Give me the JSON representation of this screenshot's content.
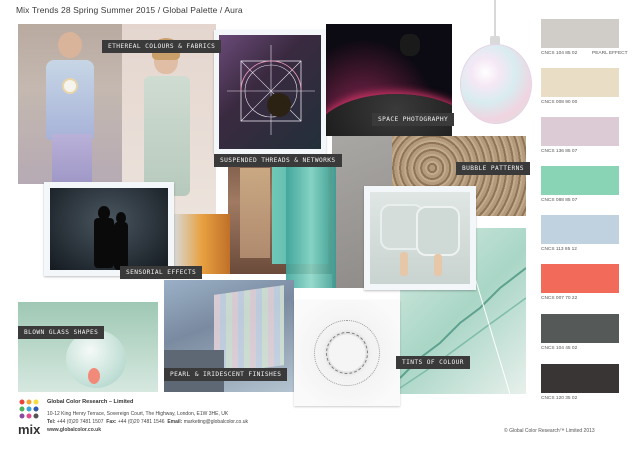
{
  "header": {
    "title": "Mix Trends 28 Spring Summer 2015 / Global Palette / Aura"
  },
  "labels": {
    "ethereal": "ETHEREAL COLOURS & FABRICS",
    "suspended": "SUSPENDED THREADS & NETWORKS",
    "space": "SPACE PHOTOGRAPHY",
    "bubble": "BUBBLE PATTERNS",
    "sensorial": "SENSORIAL EFFECTS",
    "blown": "BLOWN GLASS SHAPES",
    "pearl": "PEARL & IRIDESCENT FINISHES",
    "tints": "TINTS OF COLOUR"
  },
  "palette": {
    "swatches": [
      {
        "code": "CNCS 104 85 02",
        "name": "PEARL EFFECT",
        "color": "#d0cdc8"
      },
      {
        "code": "CNCS 008 90 00",
        "name": "",
        "color": "#e9ddc6"
      },
      {
        "code": "CNCS 136 85 07",
        "name": "",
        "color": "#dccbd4"
      },
      {
        "code": "CNCS 088 85 07",
        "name": "",
        "color": "#88d4b4"
      },
      {
        "code": "CNCS 113 85 12",
        "name": "",
        "color": "#c0d2e0"
      },
      {
        "code": "CNCS 007 70 22",
        "name": "",
        "color": "#f16a5a"
      },
      {
        "code": "CNCS 104 45 02",
        "name": "",
        "color": "#555a58"
      },
      {
        "code": "CNCS 120 35 02",
        "name": "",
        "color": "#3a3535"
      }
    ]
  },
  "footer": {
    "logo": "mix",
    "company": "Global Color Research – Limited",
    "address": "10-12 King Henry Terrace, Sovereign Court, The Highway, London, E1W 3HE, UK",
    "tel_label": "Tel:",
    "tel": "+44 (0)20 7481 1507",
    "fax_label": "Fax:",
    "fax": "+44 (0)20 7481 1546",
    "email_label": "Email:",
    "email": "marketing@globalcolor.co.uk",
    "website": "www.globalcolor.co.uk",
    "copyright": "© Global Color Research™ Limited 2013"
  }
}
